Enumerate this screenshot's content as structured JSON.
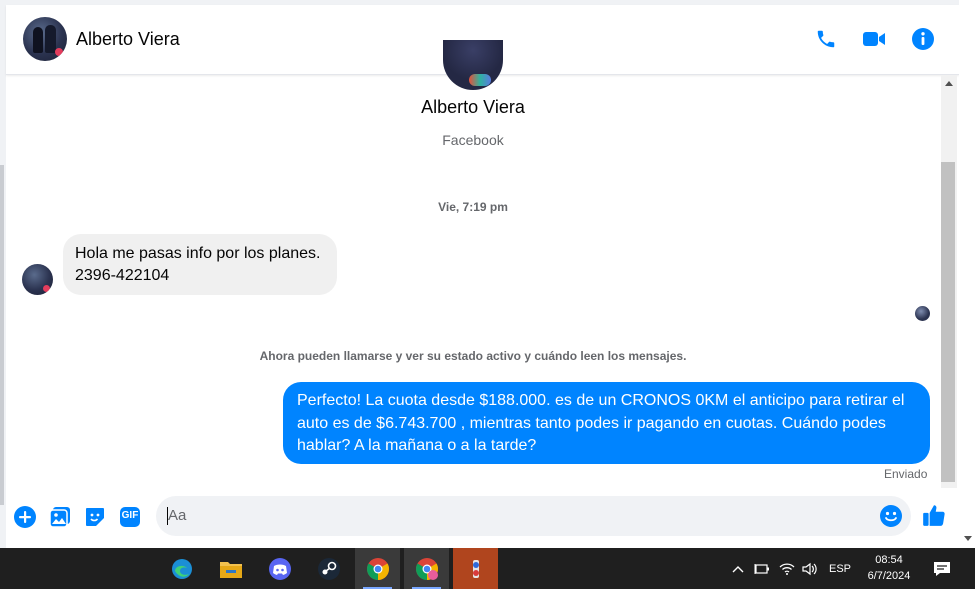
{
  "header": {
    "contact_name": "Alberto Viera",
    "actions": [
      "phone-icon",
      "video-icon",
      "info-icon"
    ]
  },
  "thread": {
    "profile_name": "Alberto Viera",
    "profile_source": "Facebook",
    "timestamp": "Vie, 7:19 pm",
    "incoming_message_line1": "Hola me pasas info por los planes.",
    "incoming_message_line2": "2396-422104",
    "notice": "Ahora pueden llamarse y ver su estado activo y cuándo leen los mensajes.",
    "outgoing_message_line1": "Perfecto! La cuota desde $188.000. es de un CRONOS 0KM el anticipo para retirar el",
    "outgoing_message_line2": "auto es de $6.743.700 , mientras tanto podes ir pagando en cuotas. Cuándo podes",
    "outgoing_message_line3": "hablar? A la mañana o a la tarde?",
    "status": "Enviado"
  },
  "composer": {
    "placeholder": "Aa",
    "tools": [
      "plus-icon",
      "image-icon",
      "sticker-icon",
      "gif-icon"
    ],
    "gif_label": "GIF"
  },
  "taskbar": {
    "apps": [
      "edge-icon",
      "file-explorer-icon",
      "discord-icon",
      "steam-icon",
      "chrome-icon",
      "chrome-profile-icon",
      "app-icon"
    ],
    "language": "ESP",
    "time": "08:54",
    "date": "6/7/2024"
  },
  "colors": {
    "accent": "#0084ff",
    "incoming_bubble": "#f0f0f0",
    "taskbar": "#1f1f1f"
  }
}
